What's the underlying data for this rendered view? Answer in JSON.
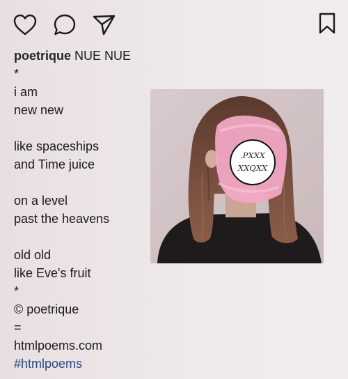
{
  "toolbar": {
    "icons": [
      "heart-icon",
      "speech-bubble-icon",
      "paper-plane-icon",
      "bookmark-icon"
    ]
  },
  "caption": {
    "username": "poetrique",
    "lines": [
      "NUE NUE",
      "*",
      "i am",
      "new new",
      "",
      "like spaceships",
      "and Time juice",
      "",
      "on a level",
      "past the heavens",
      "",
      "old old",
      "like Eve's fruit",
      "*",
      "© poetrique",
      "=",
      "htmlpoems.com",
      "#htmlpoems"
    ]
  },
  "photo": {
    "stamp_line_1": ".PXXX",
    "stamp_line_2": "XXQXX",
    "colors": {
      "background": "#d4c6c8",
      "hair": "#6b4535",
      "sweater": "#1f1b1d",
      "face_paint": "#f1a7c4"
    }
  },
  "colors": {
    "hashtag": "#284a7e",
    "text": "#1b1b1b"
  }
}
